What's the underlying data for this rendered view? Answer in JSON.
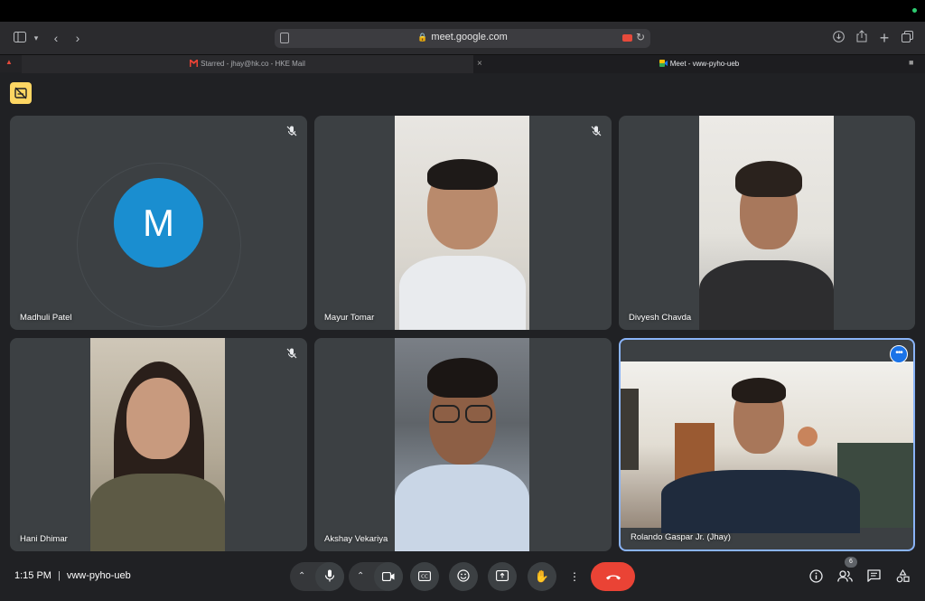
{
  "browser": {
    "url": "meet.google.com",
    "tabs": [
      {
        "label": "Starred - jhay@hk.co - HKE Mail",
        "active": false
      },
      {
        "label": "Meet - vww-pyho-ueb",
        "active": true
      }
    ]
  },
  "participants": [
    {
      "name": "Madhuli Patel",
      "initial": "M",
      "muted": true,
      "avatar_color": "#1a8ed0"
    },
    {
      "name": "Mayur Tomar",
      "muted": true
    },
    {
      "name": "Divyesh Chavda",
      "muted": false
    },
    {
      "name": "Hani Dhimar",
      "muted": true
    },
    {
      "name": "Akshay Vekariya",
      "muted": false
    },
    {
      "name": "Rolando Gaspar Jr. (Jhay)",
      "muted": false,
      "highlighted": true
    }
  ],
  "footer": {
    "time": "1:15 PM",
    "meeting_code": "vww-pyho-ueb",
    "participant_count": "6"
  },
  "colors": {
    "background": "#202124",
    "tile": "#3c4043",
    "accent": "#8ab4f8",
    "hangup": "#ea4335"
  }
}
